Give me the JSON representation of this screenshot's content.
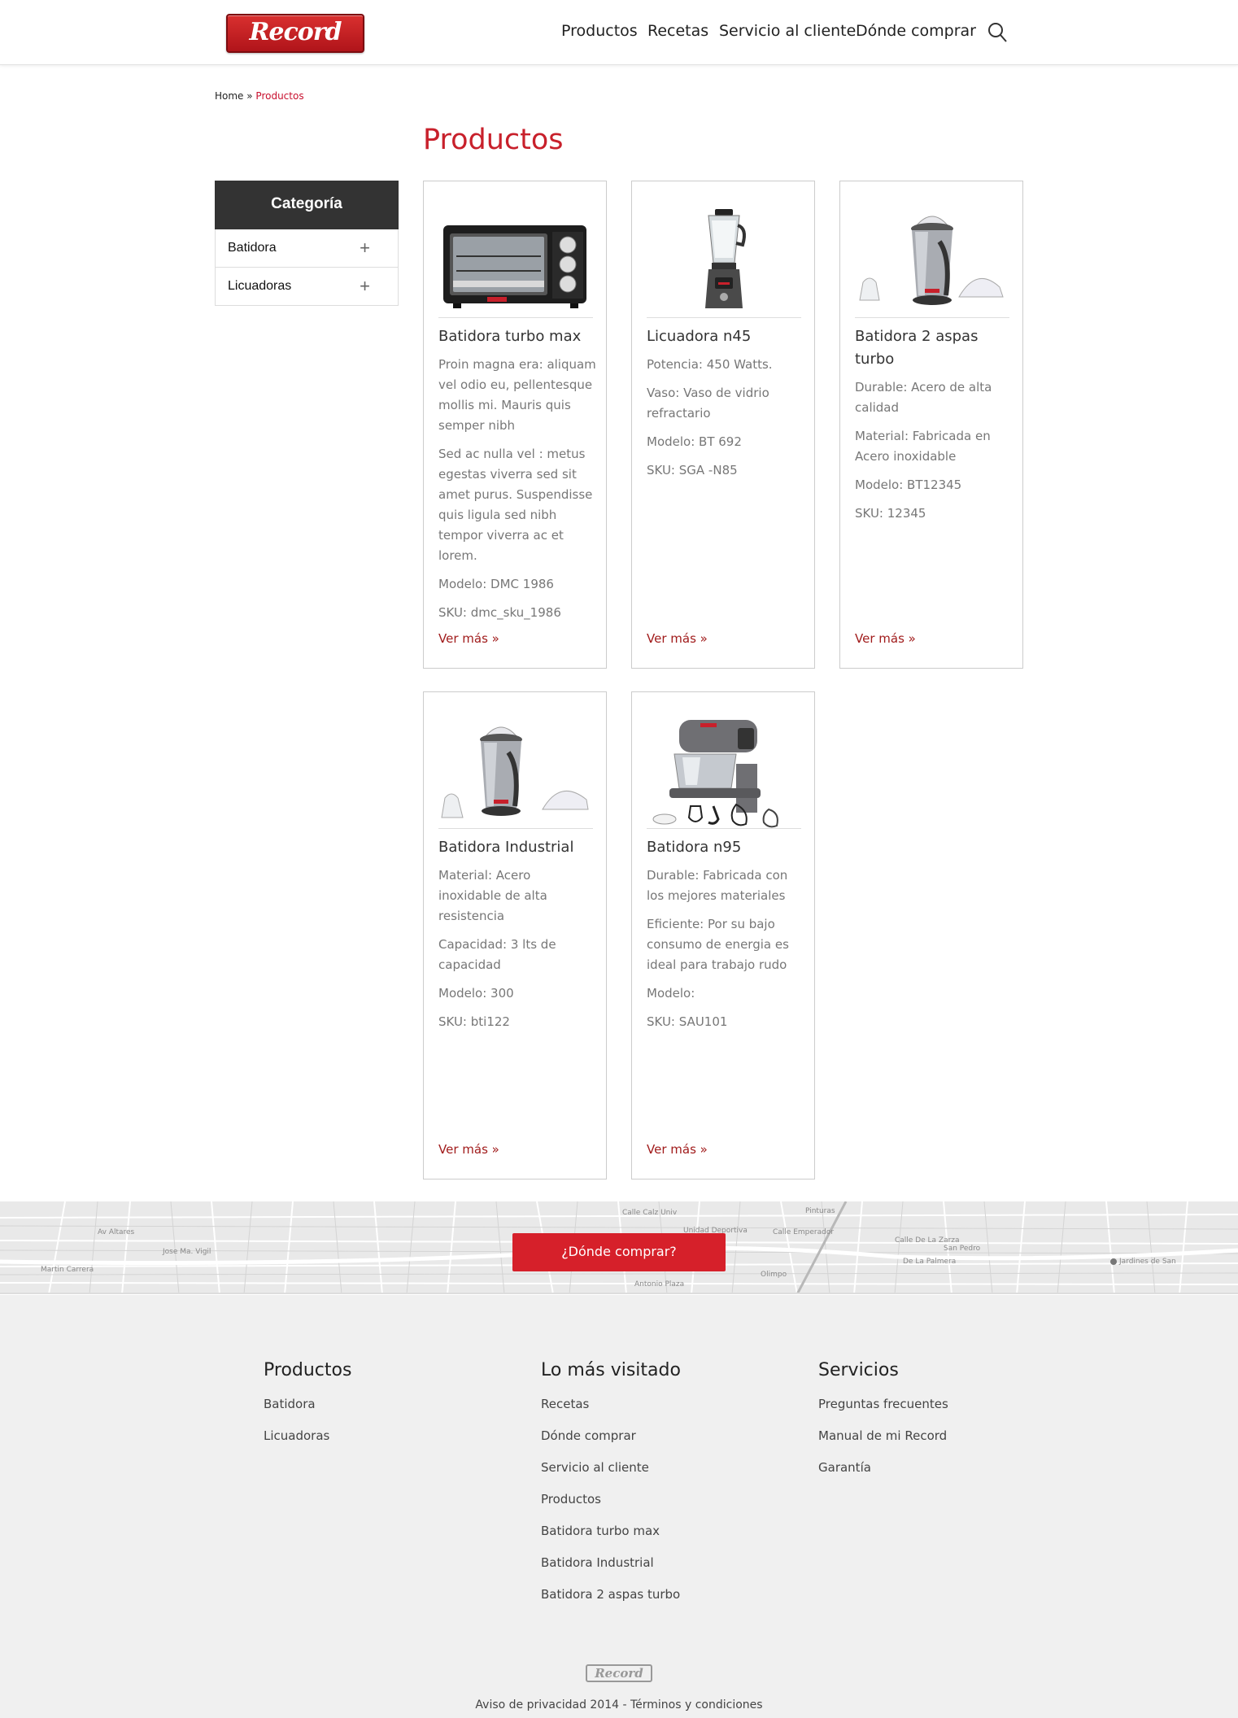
{
  "header": {
    "logo_text": "Record",
    "nav": [
      "Productos",
      "Recetas",
      "Servicio al cliente",
      "Dónde comprar"
    ],
    "search_icon": "search-icon"
  },
  "breadcrumb": {
    "home": "Home",
    "sep": " » ",
    "current": "Productos"
  },
  "page_title": "Productos",
  "sidebar": {
    "heading": "Categoría",
    "items": [
      {
        "label": "Batidora",
        "icon": "+"
      },
      {
        "label": "Licuadoras",
        "icon": "+"
      }
    ]
  },
  "products": [
    {
      "name": "Batidora turbo max",
      "image": "toaster-oven-image",
      "lines": [
        "Proin magna era: aliquam vel odio eu, pellentesque mollis mi. Mauris quis semper nibh",
        "Sed ac nulla vel : metus egestas viverra sed sit amet purus. Suspendisse quis ligula sed nibh tempor viverra ac et lorem.",
        "Modelo: DMC 1986",
        "SKU: dmc_sku_1986"
      ],
      "more": "Ver más »"
    },
    {
      "name": "Licuadora n45",
      "image": "blender-image",
      "lines": [
        "Potencia: 450 Watts.",
        "Vaso: Vaso de vidrio refractario",
        "Modelo: BT 692",
        "SKU: SGA -N85"
      ],
      "more": "Ver más »"
    },
    {
      "name": "Batidora 2 aspas turbo",
      "image": "juicer-image",
      "lines": [
        "Durable: Acero de alta calidad",
        "Material: Fabricada en Acero inoxidable",
        "Modelo: BT12345",
        "SKU: 12345"
      ],
      "more": "Ver más »"
    },
    {
      "name": "Batidora Industrial",
      "image": "juicer-image",
      "lines": [
        "Material: Acero inoxidable de alta resistencia",
        "Capacidad: 3 lts de capacidad",
        "Modelo: 300",
        "SKU: bti122"
      ],
      "more": "Ver más »"
    },
    {
      "name": "Batidora n95",
      "image": "stand-mixer-image",
      "lines": [
        "Durable: Fabricada con los mejores materiales",
        "Eficiente: Por su bajo consumo de energia es ideal para trabajo rudo",
        "Modelo:",
        "SKU: SAU101"
      ],
      "more": "Ver más »"
    }
  ],
  "map": {
    "button": "¿Dónde comprar?",
    "labels": [
      "Calle Calz Univ",
      "Unidad Deportiva",
      "Calle Emperador",
      "Pinturas",
      "Jose Ma. Vigil",
      "Martin Carrera",
      "De La Palmera",
      "Jardines de San",
      "Olimpo",
      "Antonio Plaza",
      "Av Altares",
      "Calle De La Zarza",
      "San Pedro"
    ]
  },
  "footer": {
    "columns": [
      {
        "heading": "Productos",
        "links": [
          "Batidora",
          "Licuadoras"
        ]
      },
      {
        "heading": "Lo más visitado",
        "links": [
          "Recetas",
          "Dónde comprar",
          "Servicio al cliente",
          "Productos",
          "Batidora turbo max",
          "Batidora Industrial",
          "Batidora 2 aspas turbo"
        ]
      },
      {
        "heading": "Servicios",
        "links": [
          "Preguntas frecuentes",
          "Manual de mi Record",
          "Garantía"
        ]
      }
    ],
    "logo_text": "Record",
    "copyright": "Aviso de privacidad 2014 - Términos y condiciones"
  },
  "colors": {
    "accent": "#c8202b",
    "button": "#d6202a",
    "link": "#a11c1c",
    "sidebar_head": "#333333",
    "footer_bg": "#f0f0f0"
  }
}
